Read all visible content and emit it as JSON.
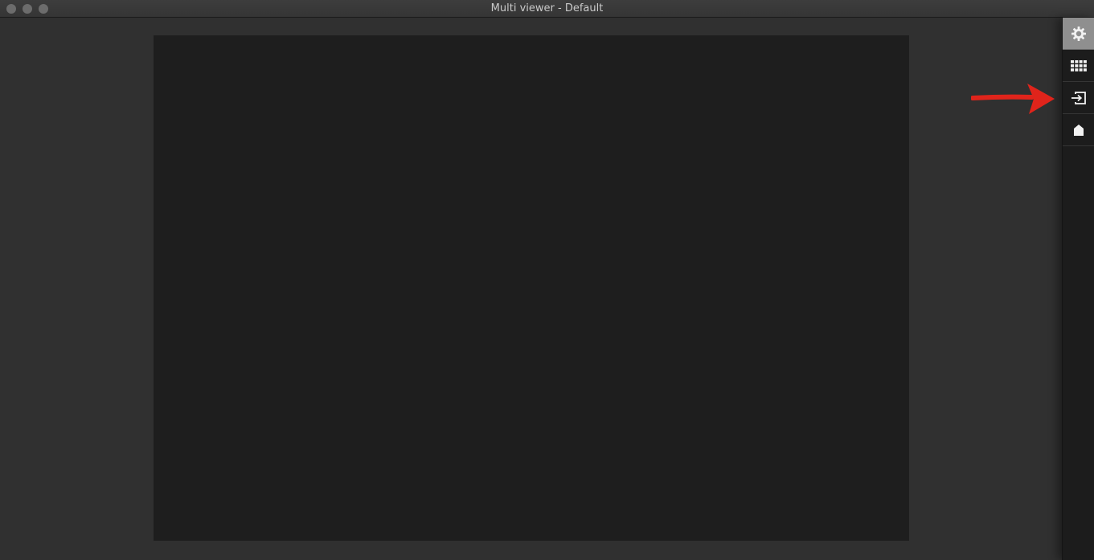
{
  "window": {
    "title": "Multi viewer - Default",
    "controls": [
      "close",
      "minimize",
      "maximize"
    ]
  },
  "sidebar": {
    "buttons": [
      {
        "icon": "gear-icon",
        "active": true
      },
      {
        "icon": "grid-icon",
        "active": false
      },
      {
        "icon": "input-icon",
        "active": false
      },
      {
        "icon": "home-icon",
        "active": false
      }
    ]
  },
  "annotation": {
    "color": "#e0241b",
    "points_to": "input-icon"
  },
  "colors": {
    "background": "#303030",
    "viewer": "#1e1e1e",
    "sidebar": "#1c1c1c",
    "active_button": "#8f8f8f"
  }
}
